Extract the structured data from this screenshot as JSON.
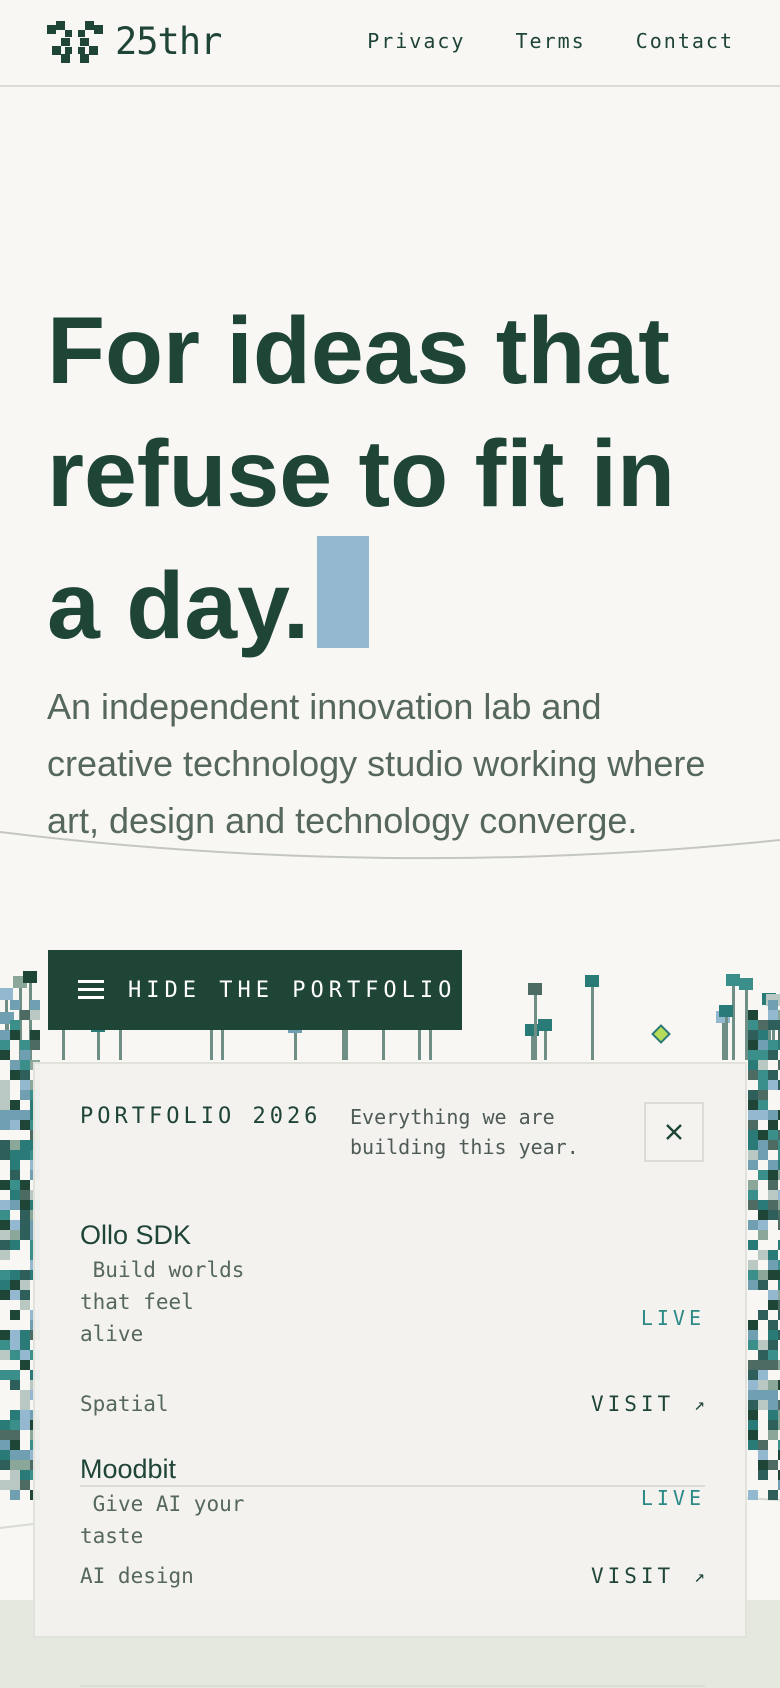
{
  "header": {
    "logo_text": "25thr",
    "nav": [
      "Privacy",
      "Terms",
      "Contact"
    ]
  },
  "hero": {
    "title": "For ideas that refuse to fit in a day.",
    "subtitle": "An independent innovation lab and creative technology studio working where art, design and technology converge."
  },
  "cta": {
    "label": "HIDE THE PORTFOLIO",
    "icon": "menu-icon"
  },
  "portfolio": {
    "title": "PORTFOLIO 2026",
    "description": "Everything we are building this year.",
    "close_icon": "close-icon",
    "items": [
      {
        "name": "Ollo SDK",
        "tagline": " Build worlds that feel alive",
        "category": "Spatial",
        "status": "LIVE",
        "visit_label": "VISIT",
        "visit_icon": "↗"
      },
      {
        "name": "Moodbit",
        "tagline": " Give AI your taste",
        "category": "AI design",
        "status": "LIVE",
        "visit_label": "VISIT",
        "visit_icon": "↗"
      }
    ]
  },
  "colors": {
    "brand": "#1f4537",
    "background": "#f8f7f4",
    "accent_block": "#93b8cf",
    "status": "#2c8a86"
  }
}
